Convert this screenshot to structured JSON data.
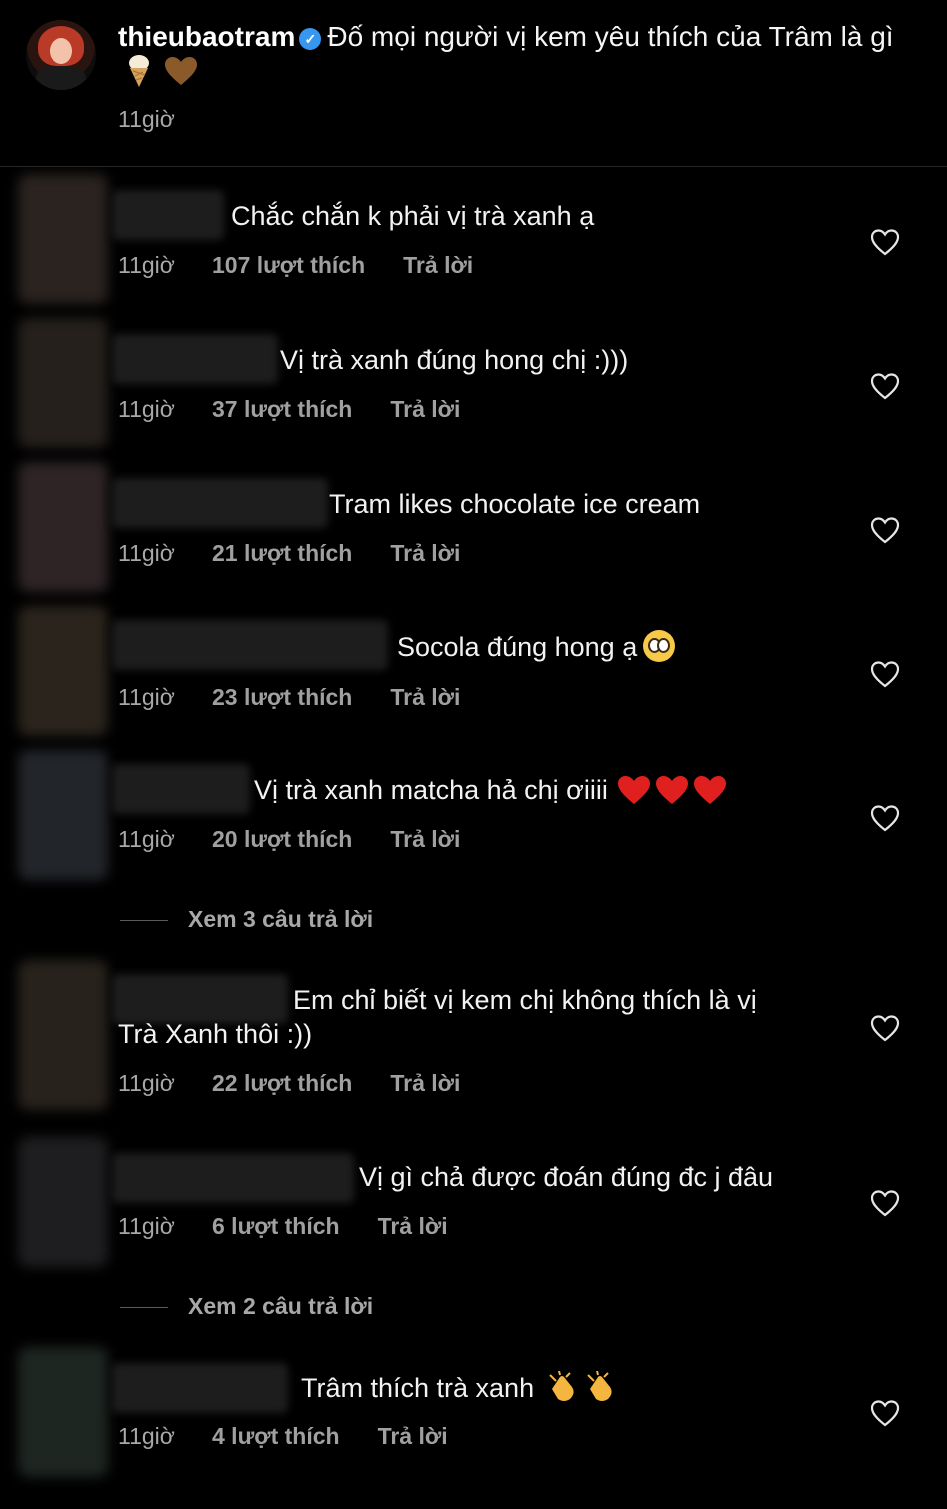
{
  "post": {
    "username": "thieubaotram",
    "verified": true,
    "caption": "Đố mọi người vị kem yêu thích của Trâm là gì",
    "caption_emojis": [
      "ice-cream",
      "brown-heart"
    ],
    "time": "11giờ"
  },
  "comments": [
    {
      "text": "Chắc chắn k phải vị trà xanh ạ",
      "time": "11giờ",
      "likes": "107 lượt thích",
      "reply": "Trả lời"
    },
    {
      "text": "Vị trà xanh đúng hong chị :)))",
      "time": "11giờ",
      "likes": "37 lượt thích",
      "reply": "Trả lời"
    },
    {
      "text": "Tram likes chocolate ice cream",
      "time": "11giờ",
      "likes": "21 lượt thích",
      "reply": "Trả lời"
    },
    {
      "text": "Socola đúng hong ạ",
      "time": "11giờ",
      "likes": "23 lượt thích",
      "reply": "Trả lời"
    },
    {
      "text": "Vị trà xanh matcha hả chị ơiiii",
      "time": "11giờ",
      "likes": "20 lượt thích",
      "reply": "Trả lời"
    },
    {
      "text_line1": "Em chỉ biết vị kem chị không thích là vị",
      "text_line2": "Trà Xanh thôi :))",
      "time": "11giờ",
      "likes": "22 lượt thích",
      "reply": "Trả lời"
    },
    {
      "text": "Vị gì chả được đoán đúng đc j đâu",
      "time": "11giờ",
      "likes": "6 lượt thích",
      "reply": "Trả lời"
    },
    {
      "text": "Trâm thích trà xanh",
      "time": "11giờ",
      "likes": "4 lượt thích",
      "reply": "Trả lời"
    }
  ],
  "view_replies": [
    {
      "label": "Xem 3 câu trả lời"
    },
    {
      "label": "Xem 2 câu trả lời"
    }
  ],
  "colors": {
    "background": "#000000",
    "text_primary": "#f5f5f5",
    "text_secondary": "#a8a8a8",
    "verified": "#3797f0",
    "heart_emoji": "#e0201f"
  }
}
